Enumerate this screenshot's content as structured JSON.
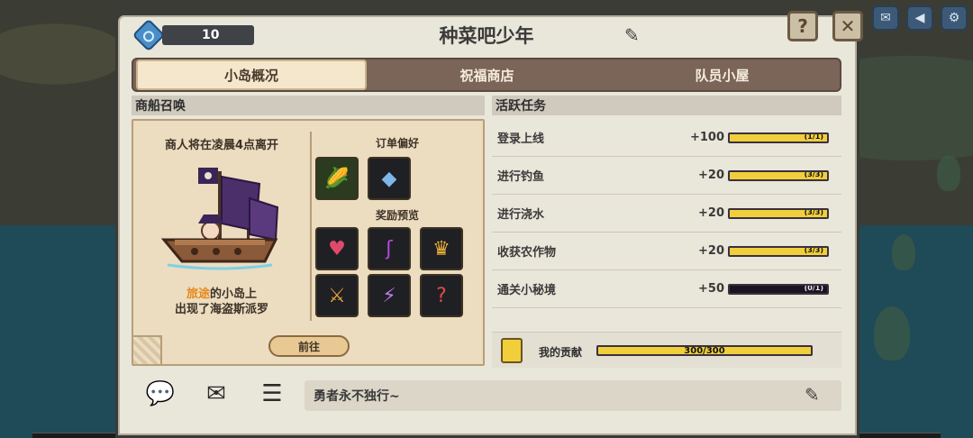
{
  "header": {
    "gem_count": "10",
    "title": "种菜吧少年"
  },
  "tabs": [
    {
      "label": "小岛概况",
      "active": true
    },
    {
      "label": "祝福商店",
      "active": false
    },
    {
      "label": "队员小屋",
      "active": false
    }
  ],
  "ship": {
    "section_title": "商船召唤",
    "depart_text": "商人将在凌晨4点离开",
    "order_pref_label": "订单偏好",
    "reward_preview_label": "奖励预览",
    "news_highlight": "旅途",
    "news_line1_rest": "的小岛上",
    "news_line2": "出现了海盗斯派罗",
    "go_button": "前往"
  },
  "tasks": {
    "section_title": "活跃任务",
    "items": [
      {
        "name": "登录上线",
        "reward": "+100",
        "count": "(1/1)",
        "progress": 1.0
      },
      {
        "name": "进行钓鱼",
        "reward": "+20",
        "count": "(3/3)",
        "progress": 1.0
      },
      {
        "name": "进行浇水",
        "reward": "+20",
        "count": "(3/3)",
        "progress": 1.0
      },
      {
        "name": "收获农作物",
        "reward": "+20",
        "count": "(3/3)",
        "progress": 1.0
      },
      {
        "name": "通关小秘境",
        "reward": "+50",
        "count": "(0/1)",
        "progress": 0.0
      }
    ]
  },
  "contribution": {
    "label": "我的贡献",
    "value": "300/300",
    "progress": 1.0
  },
  "footer": {
    "motto": "勇者永不独行~"
  },
  "colors": {
    "accent_yellow": "#f1cf3a",
    "tab_bar": "#7b6558",
    "panel_bg": "#e9e6da",
    "highlight_orange": "#e58a1c"
  }
}
